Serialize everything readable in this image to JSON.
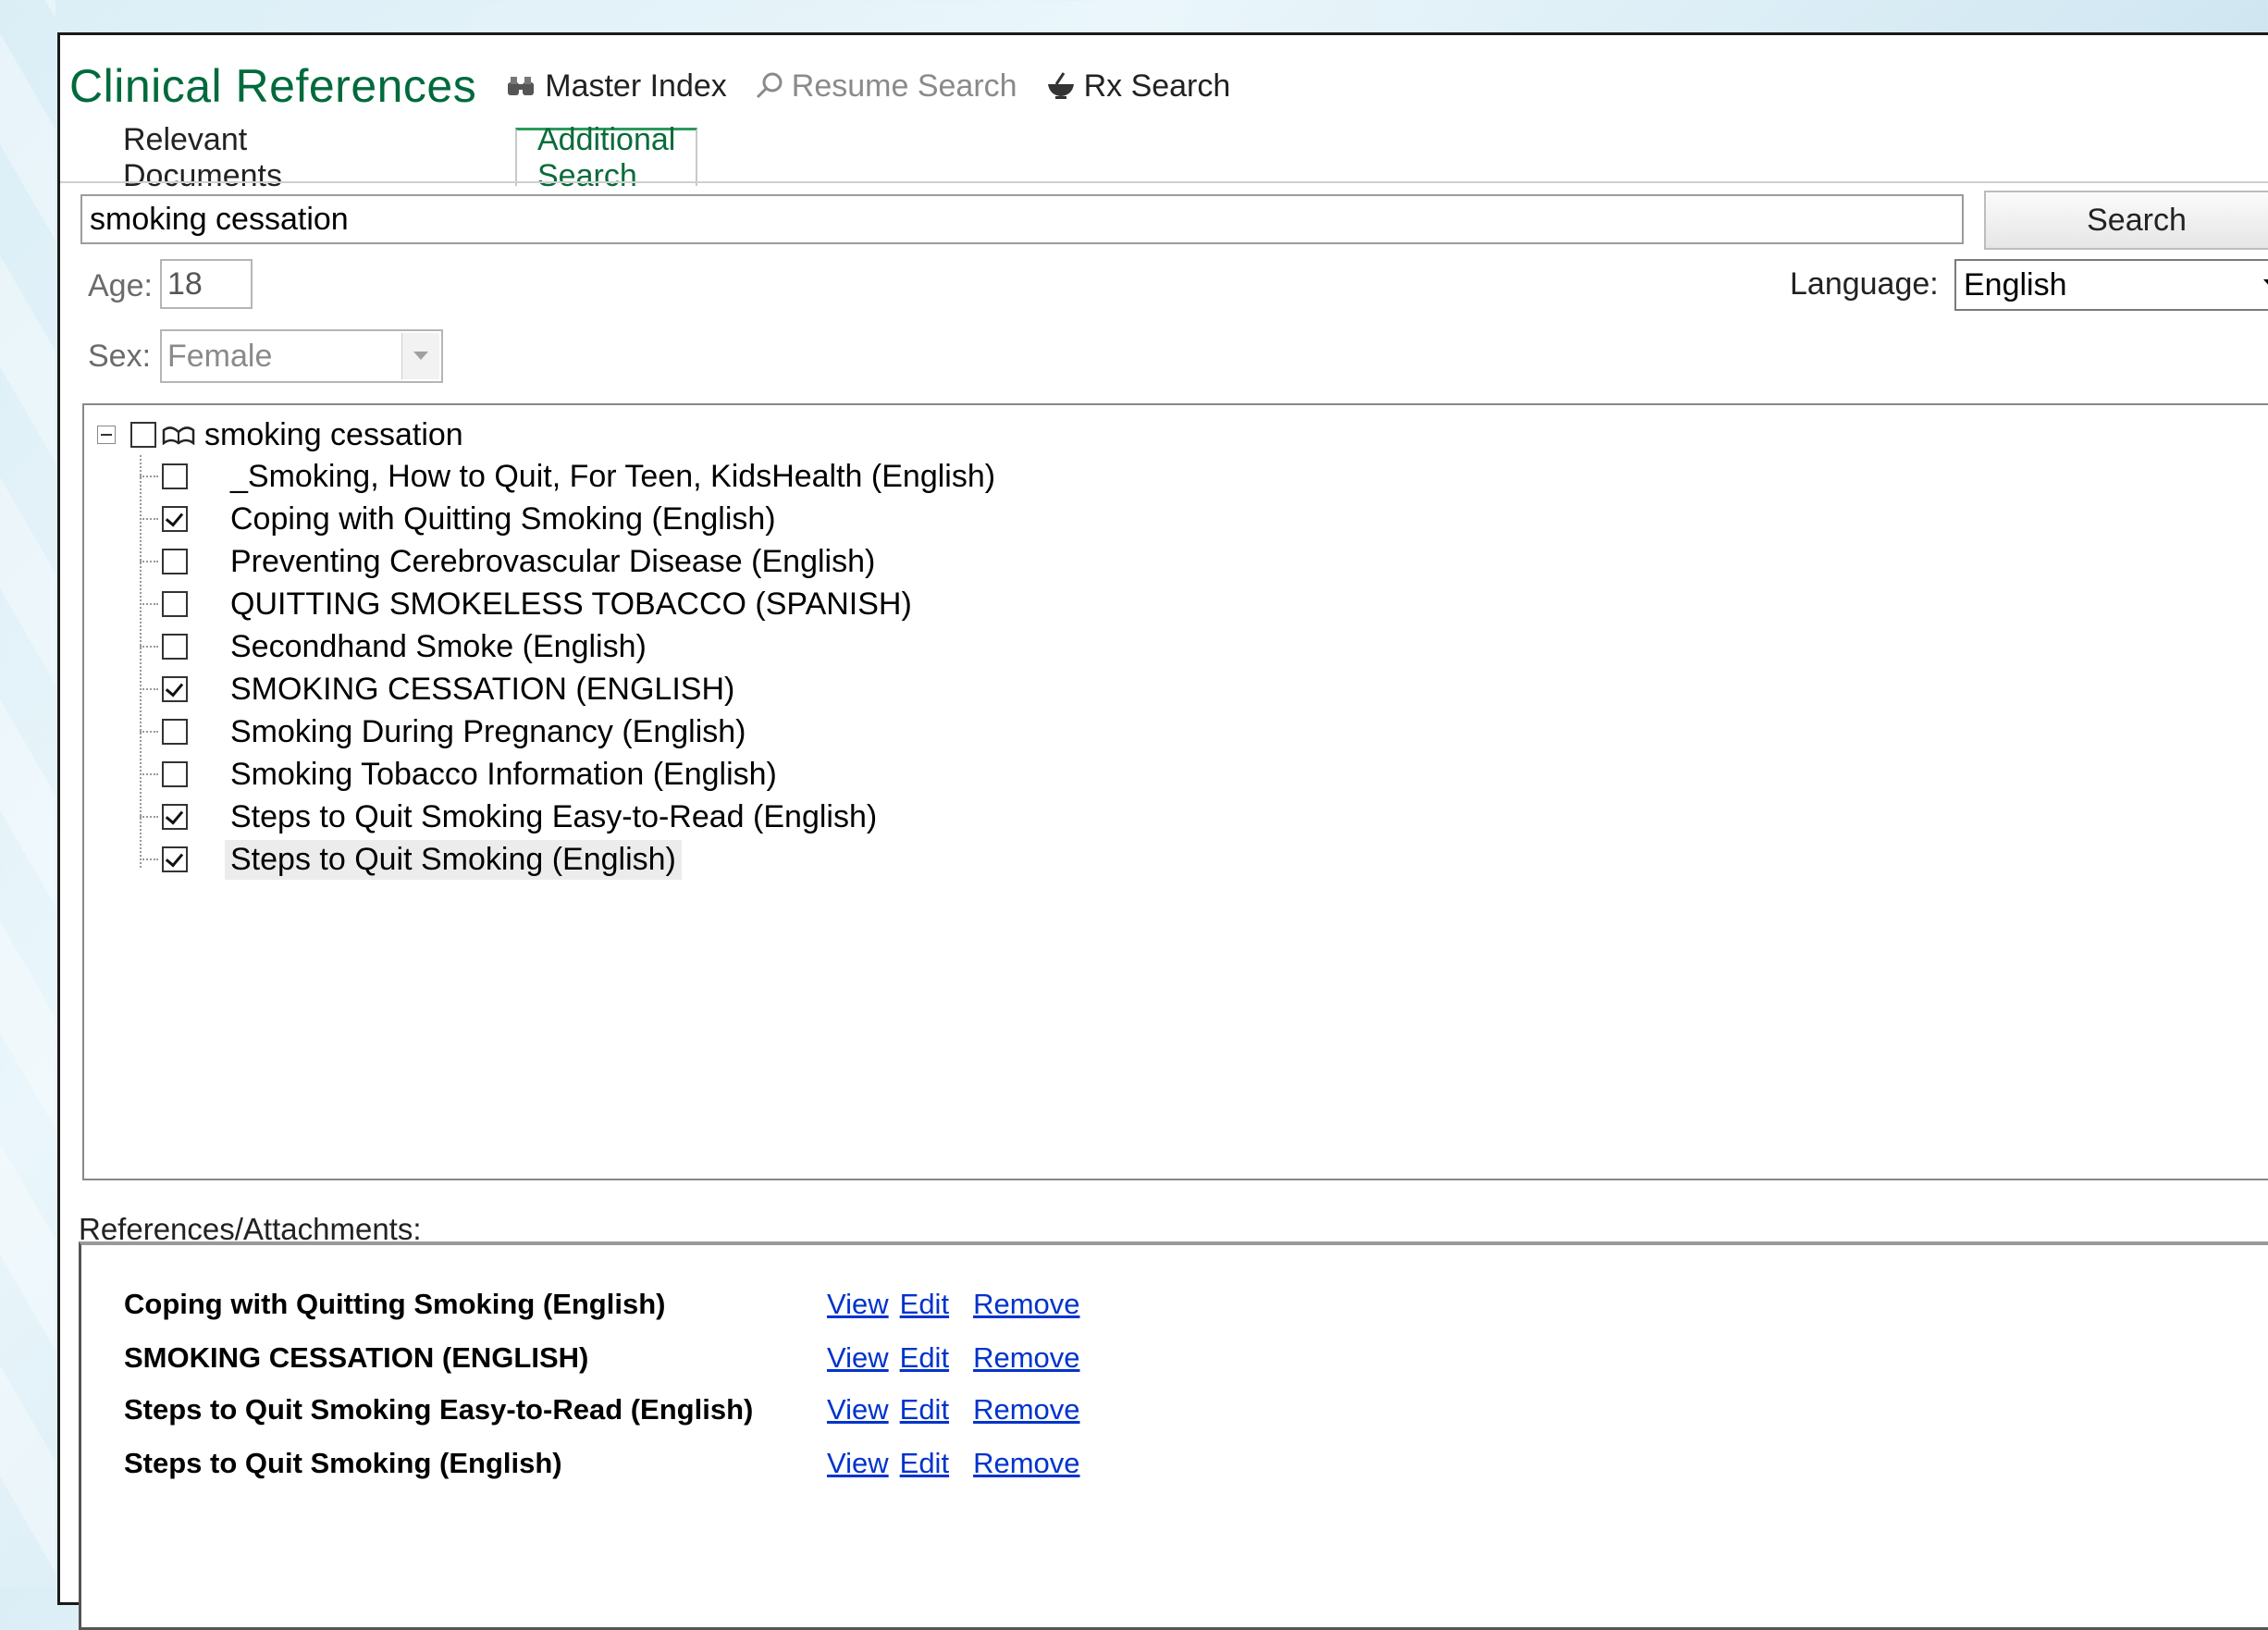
{
  "app": {
    "title": "Clinical References",
    "toolbar": {
      "master_index": "Master Index",
      "resume_search": "Resume Search",
      "rx_search": "Rx Search"
    }
  },
  "tabs": [
    {
      "label": "Relevant Documents",
      "active": false
    },
    {
      "label": "Additional Search",
      "active": true
    }
  ],
  "search": {
    "value": "smoking cessation",
    "button_label": "Search"
  },
  "filters": {
    "age_label": "Age:",
    "age_value": "18",
    "sex_label": "Sex:",
    "sex_value": "Female",
    "language_label": "Language:",
    "language_value": "English"
  },
  "tree": {
    "root_label": "smoking cessation",
    "items": [
      {
        "label": "_Smoking, How to Quit, For Teen, KidsHealth (English)",
        "checked": false
      },
      {
        "label": "Coping with Quitting Smoking (English)",
        "checked": true
      },
      {
        "label": "Preventing Cerebrovascular Disease (English)",
        "checked": false
      },
      {
        "label": "QUITTING SMOKELESS TOBACCO (SPANISH)",
        "checked": false
      },
      {
        "label": "Secondhand Smoke (English)",
        "checked": false
      },
      {
        "label": "SMOKING CESSATION (ENGLISH)",
        "checked": true
      },
      {
        "label": "Smoking During Pregnancy (English)",
        "checked": false
      },
      {
        "label": "Smoking Tobacco Information (English)",
        "checked": false
      },
      {
        "label": "Steps to Quit Smoking  Easy-to-Read (English)",
        "checked": true
      },
      {
        "label": "Steps to Quit Smoking (English)",
        "checked": true,
        "selected": true
      }
    ]
  },
  "references": {
    "label": "References/Attachments:",
    "link_view": "View",
    "link_edit": "Edit",
    "link_remove": "Remove",
    "items": [
      {
        "name": "Coping with Quitting Smoking (English)"
      },
      {
        "name": "SMOKING CESSATION (ENGLISH)"
      },
      {
        "name": "Steps to Quit Smoking Easy-to-Read (English)"
      },
      {
        "name": "Steps to Quit Smoking (English)"
      }
    ]
  }
}
